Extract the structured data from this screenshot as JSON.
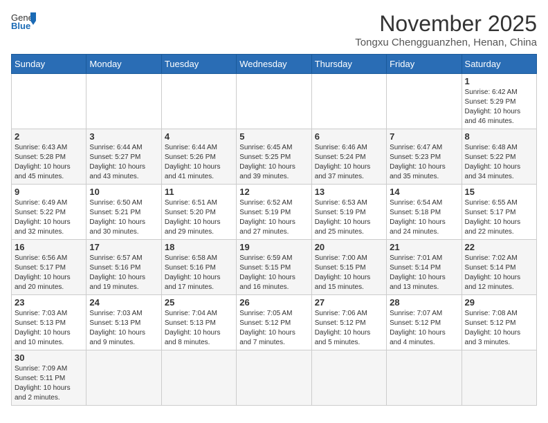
{
  "header": {
    "logo_general": "General",
    "logo_blue": "Blue",
    "month_title": "November 2025",
    "location": "Tongxu Chengguanzhen, Henan, China"
  },
  "weekdays": [
    "Sunday",
    "Monday",
    "Tuesday",
    "Wednesday",
    "Thursday",
    "Friday",
    "Saturday"
  ],
  "days": [
    {
      "date": 1,
      "col": 6,
      "info": "Sunrise: 6:42 AM\nSunset: 5:29 PM\nDaylight: 10 hours and 46 minutes."
    },
    {
      "date": 2,
      "info": "Sunrise: 6:43 AM\nSunset: 5:28 PM\nDaylight: 10 hours and 45 minutes."
    },
    {
      "date": 3,
      "info": "Sunrise: 6:44 AM\nSunset: 5:27 PM\nDaylight: 10 hours and 43 minutes."
    },
    {
      "date": 4,
      "info": "Sunrise: 6:44 AM\nSunset: 5:26 PM\nDaylight: 10 hours and 41 minutes."
    },
    {
      "date": 5,
      "info": "Sunrise: 6:45 AM\nSunset: 5:25 PM\nDaylight: 10 hours and 39 minutes."
    },
    {
      "date": 6,
      "info": "Sunrise: 6:46 AM\nSunset: 5:24 PM\nDaylight: 10 hours and 37 minutes."
    },
    {
      "date": 7,
      "info": "Sunrise: 6:47 AM\nSunset: 5:23 PM\nDaylight: 10 hours and 35 minutes."
    },
    {
      "date": 8,
      "info": "Sunrise: 6:48 AM\nSunset: 5:22 PM\nDaylight: 10 hours and 34 minutes."
    },
    {
      "date": 9,
      "info": "Sunrise: 6:49 AM\nSunset: 5:22 PM\nDaylight: 10 hours and 32 minutes."
    },
    {
      "date": 10,
      "info": "Sunrise: 6:50 AM\nSunset: 5:21 PM\nDaylight: 10 hours and 30 minutes."
    },
    {
      "date": 11,
      "info": "Sunrise: 6:51 AM\nSunset: 5:20 PM\nDaylight: 10 hours and 29 minutes."
    },
    {
      "date": 12,
      "info": "Sunrise: 6:52 AM\nSunset: 5:19 PM\nDaylight: 10 hours and 27 minutes."
    },
    {
      "date": 13,
      "info": "Sunrise: 6:53 AM\nSunset: 5:19 PM\nDaylight: 10 hours and 25 minutes."
    },
    {
      "date": 14,
      "info": "Sunrise: 6:54 AM\nSunset: 5:18 PM\nDaylight: 10 hours and 24 minutes."
    },
    {
      "date": 15,
      "info": "Sunrise: 6:55 AM\nSunset: 5:17 PM\nDaylight: 10 hours and 22 minutes."
    },
    {
      "date": 16,
      "info": "Sunrise: 6:56 AM\nSunset: 5:17 PM\nDaylight: 10 hours and 20 minutes."
    },
    {
      "date": 17,
      "info": "Sunrise: 6:57 AM\nSunset: 5:16 PM\nDaylight: 10 hours and 19 minutes."
    },
    {
      "date": 18,
      "info": "Sunrise: 6:58 AM\nSunset: 5:16 PM\nDaylight: 10 hours and 17 minutes."
    },
    {
      "date": 19,
      "info": "Sunrise: 6:59 AM\nSunset: 5:15 PM\nDaylight: 10 hours and 16 minutes."
    },
    {
      "date": 20,
      "info": "Sunrise: 7:00 AM\nSunset: 5:15 PM\nDaylight: 10 hours and 15 minutes."
    },
    {
      "date": 21,
      "info": "Sunrise: 7:01 AM\nSunset: 5:14 PM\nDaylight: 10 hours and 13 minutes."
    },
    {
      "date": 22,
      "info": "Sunrise: 7:02 AM\nSunset: 5:14 PM\nDaylight: 10 hours and 12 minutes."
    },
    {
      "date": 23,
      "info": "Sunrise: 7:03 AM\nSunset: 5:13 PM\nDaylight: 10 hours and 10 minutes."
    },
    {
      "date": 24,
      "info": "Sunrise: 7:03 AM\nSunset: 5:13 PM\nDaylight: 10 hours and 9 minutes."
    },
    {
      "date": 25,
      "info": "Sunrise: 7:04 AM\nSunset: 5:13 PM\nDaylight: 10 hours and 8 minutes."
    },
    {
      "date": 26,
      "info": "Sunrise: 7:05 AM\nSunset: 5:12 PM\nDaylight: 10 hours and 7 minutes."
    },
    {
      "date": 27,
      "info": "Sunrise: 7:06 AM\nSunset: 5:12 PM\nDaylight: 10 hours and 5 minutes."
    },
    {
      "date": 28,
      "info": "Sunrise: 7:07 AM\nSunset: 5:12 PM\nDaylight: 10 hours and 4 minutes."
    },
    {
      "date": 29,
      "info": "Sunrise: 7:08 AM\nSunset: 5:12 PM\nDaylight: 10 hours and 3 minutes."
    },
    {
      "date": 30,
      "info": "Sunrise: 7:09 AM\nSunset: 5:11 PM\nDaylight: 10 hours and 2 minutes."
    }
  ]
}
